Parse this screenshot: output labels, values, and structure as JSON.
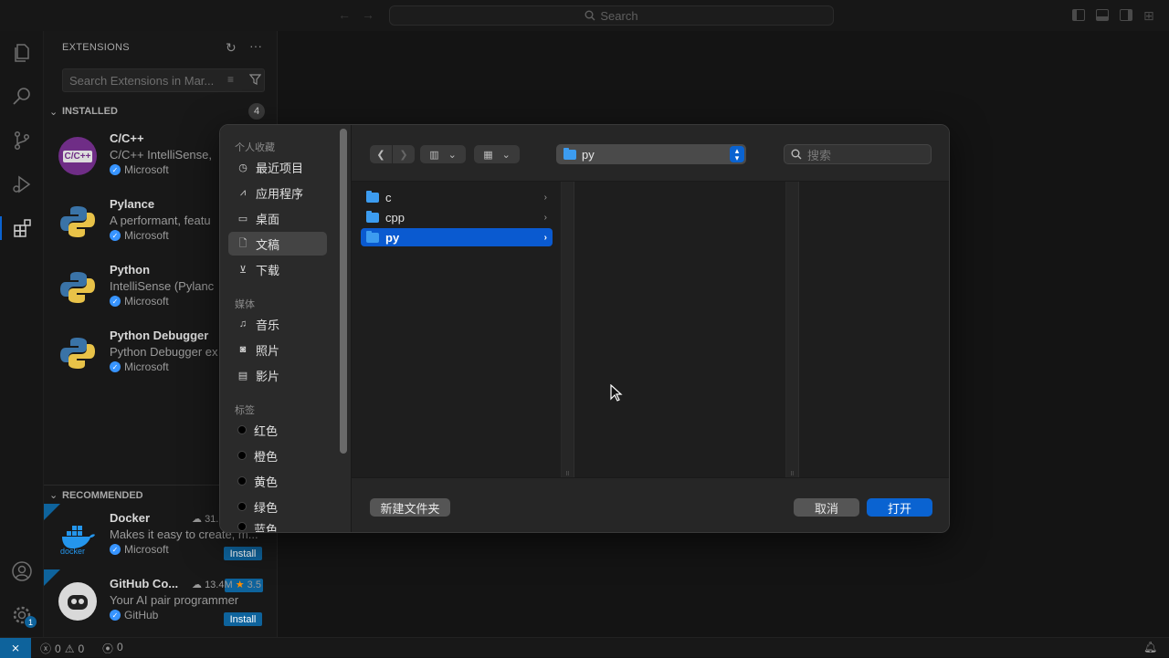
{
  "titlebar": {
    "search_label": "Search"
  },
  "sidebar": {
    "title": "EXTENSIONS",
    "search_placeholder": "Search Extensions in Mar...",
    "installed_label": "INSTALLED",
    "installed_count": "4",
    "recommended_label": "RECOMMENDED",
    "installed": [
      {
        "name": "C/C++",
        "desc": "C/C++ IntelliSense,",
        "publisher": "Microsoft"
      },
      {
        "name": "Pylance",
        "desc": "A performant, featu",
        "publisher": "Microsoft"
      },
      {
        "name": "Python",
        "desc": "IntelliSense (Pylanc",
        "publisher": "Microsoft"
      },
      {
        "name": "Python Debugger",
        "desc": "Python Debugger ex",
        "publisher": "Microsoft"
      }
    ],
    "recommended": [
      {
        "name": "Docker",
        "installs": "31.",
        "desc": "Makes it easy to create, m...",
        "publisher": "Microsoft",
        "install_label": "Install"
      },
      {
        "name": "GitHub Co...",
        "installs": "13.4M",
        "rating": "3.5",
        "desc": "Your AI pair programmer",
        "publisher": "GitHub",
        "install_label": "Install"
      }
    ],
    "cpp_logo_text": "C/C++"
  },
  "dialog": {
    "favorites_label": "个人收藏",
    "favorites": [
      {
        "label": "最近项目",
        "icon": "clock-icon"
      },
      {
        "label": "应用程序",
        "icon": "apps-icon"
      },
      {
        "label": "桌面",
        "icon": "desktop-icon"
      },
      {
        "label": "文稿",
        "icon": "document-icon"
      },
      {
        "label": "下载",
        "icon": "download-icon"
      }
    ],
    "media_label": "媒体",
    "media": [
      {
        "label": "音乐",
        "icon": "music-icon"
      },
      {
        "label": "照片",
        "icon": "camera-icon"
      },
      {
        "label": "影片",
        "icon": "film-icon"
      }
    ],
    "tags_label": "标签",
    "tags": [
      "红色",
      "橙色",
      "黄色",
      "绿色",
      "蓝色"
    ],
    "current_folder": "py",
    "search_placeholder": "搜索",
    "folders": [
      {
        "name": "c"
      },
      {
        "name": "cpp"
      },
      {
        "name": "py"
      }
    ],
    "new_folder_label": "新建文件夹",
    "cancel_label": "取消",
    "open_label": "打开"
  },
  "statusbar": {
    "errors": "0",
    "warnings": "0",
    "ports": "0"
  },
  "colors": {
    "accent": "#0a63d1",
    "vscode_blue": "#0e639c",
    "folder": "#3c9cf0"
  }
}
